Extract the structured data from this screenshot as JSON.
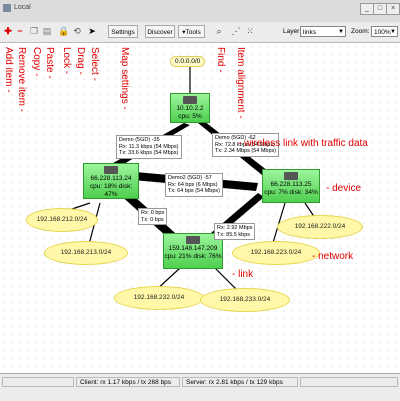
{
  "window": {
    "title": "Local"
  },
  "toolbar": {
    "settings_label": "Settings",
    "discover_label": "Discover",
    "tools_label": "Tools",
    "layer_label": "Layer:",
    "layer_value": "links",
    "zoom_label": "Zoom:",
    "zoom_value": "100%"
  },
  "annotations": {
    "add_item": "Add item -",
    "remove_item": "Remove item -",
    "copy": "Copy -",
    "paste": "Paste -",
    "lock": "Lock -",
    "drag": "Drag -",
    "select": "Select -",
    "map_settings": "Map settings -",
    "find": "Find -",
    "item_alignment": "Item alignment -",
    "wireless_link": "- wireless link with traffic data",
    "device": "- device",
    "network": "- network",
    "link": "- link"
  },
  "map": {
    "top_address": "0.0.0.0/0",
    "nodes": {
      "top": {
        "ip": "10.10.2.2",
        "stats": "cpu: 5%"
      },
      "left": {
        "ip": "66.228.113.24",
        "stats": "cpu: 18% disk: 47%"
      },
      "right": {
        "ip": "66.228.113.25",
        "stats": "cpu: 7% disk: 34%"
      },
      "bottom": {
        "ip": "159.148.147.209",
        "stats": "cpu: 21% disk: 76%"
      }
    },
    "networks": {
      "n212": "192.168.212.0/24",
      "n213": "192.168.213.0/24",
      "n222": "192.168.222.0/24",
      "n223": "192.168.223.0/24",
      "n232": "192.168.232.0/24",
      "n233": "192.168.233.0/24"
    },
    "traffic": {
      "t1": "Demo (5GD) -35\nRx: 11.3 kbps (54 Mbps)\nTx: 33.6 kbps (54 Mbps)",
      "t2": "Demo (5GD) -62\nRx: 72.8 kbps (54 Mbps)\nTx: 2.34 Mbps (54 Mbps)",
      "t3": "Demo2 (5GD) -57\nRx: 64 bps (6 Mbps)\nTx: 64 bps (54 Mbps)",
      "t4": "Rx: 0 bps\nTx: 0 bps",
      "t5": "Rx: 2.92 Mbps\nTx: 85.5 kbps"
    }
  },
  "status": {
    "client": "Client: rx 1.17 kbps / tx 268 bps",
    "server": "Server: rx 2.81 kbps / tx 129 kbps"
  }
}
